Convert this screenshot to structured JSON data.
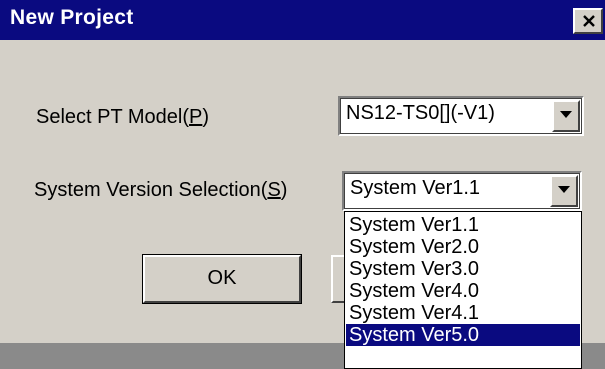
{
  "dialog": {
    "title": "New Project",
    "close_icon": "close-icon"
  },
  "pt_model": {
    "label_text": "Select PT Model(",
    "label_accel": "P",
    "label_end": ")",
    "value": "NS12-TS0[](-V1)"
  },
  "system_version": {
    "label_text": "System Version Selection(",
    "label_accel": "S",
    "label_end": ")",
    "value": "System Ver1.1",
    "options": [
      "System Ver1.1",
      "System Ver2.0",
      "System Ver3.0",
      "System Ver4.0",
      "System Ver4.1",
      "System Ver5.0"
    ],
    "highlighted": "System Ver5.0"
  },
  "buttons": {
    "ok_label": "OK"
  },
  "colors": {
    "titlebar": "#0a0a80",
    "face": "#d4d0c8",
    "selection": "#0a0a80"
  }
}
